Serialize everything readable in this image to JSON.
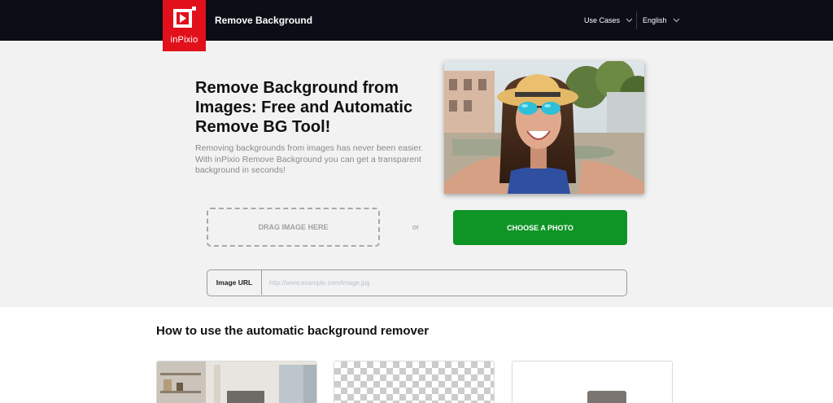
{
  "header": {
    "logo_text": "inPixio",
    "title": "Remove Background",
    "nav": [
      {
        "label": "Use Cases"
      },
      {
        "label": "English"
      }
    ]
  },
  "hero": {
    "title": "Remove Background from Images: Free and Automatic Remove BG Tool!",
    "description": "Removing backgrounds from images has never been easier. With inPixio Remove Background you can get a transparent background in seconds!",
    "drop_label": "DRAG IMAGE HERE",
    "or_label": "or",
    "choose_label": "CHOOSE A PHOTO",
    "url_label": "Image URL",
    "url_placeholder": "http://www.example.com/image.jpg",
    "url_value": ""
  },
  "howto": {
    "title": "How to use the automatic background remover"
  },
  "colors": {
    "brand_red": "#e1101a",
    "primary_green": "#0f9426",
    "navbar_bg": "#0b0d17",
    "hero_bg": "#f2f2f2"
  },
  "icons": {
    "logo": "play-icon",
    "dropdown": "chevron-down-icon"
  }
}
